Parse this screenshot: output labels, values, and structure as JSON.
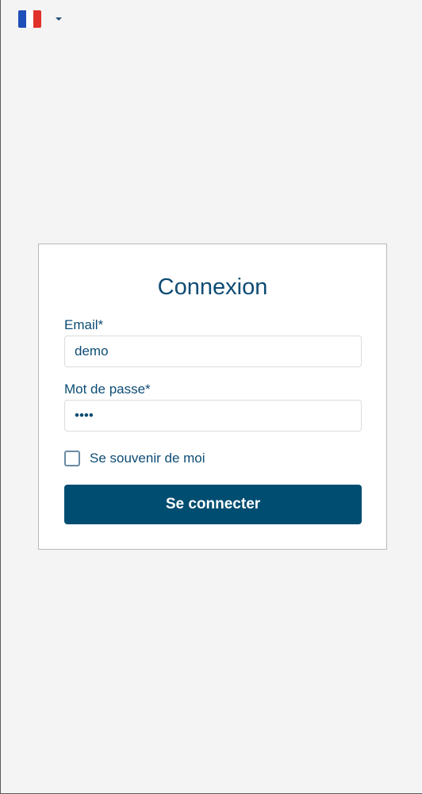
{
  "language": {
    "current": "French",
    "flag_icon": "france-flag-icon",
    "flag_colors": [
      "#1f4fb8",
      "#ffffff",
      "#e0312b"
    ],
    "dropdown_icon": "caret-down-icon"
  },
  "login": {
    "title": "Connexion",
    "email": {
      "label": "Email*",
      "value": "demo"
    },
    "password": {
      "label": "Mot de passe*",
      "value": "••••"
    },
    "remember": {
      "label": "Se souvenir de moi",
      "checked": false
    },
    "submit_label": "Se connecter"
  },
  "colors": {
    "primary": "#004d72",
    "text": "#0d4c74",
    "background": "#f4f4f4"
  }
}
